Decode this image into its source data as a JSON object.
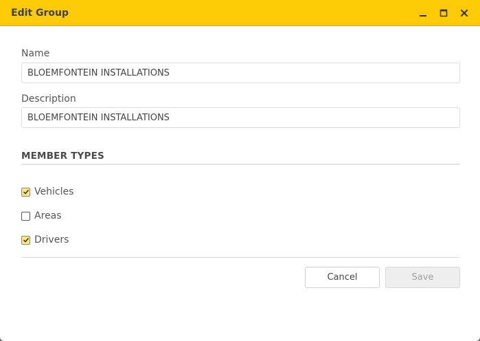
{
  "dialog": {
    "title": "Edit Group",
    "controls": {
      "minimize_icon": "minimize-icon",
      "maximize_icon": "maximize-icon",
      "close_icon": "close-icon"
    }
  },
  "form": {
    "name_label": "Name",
    "name_value": "BLOEMFONTEIN INSTALLATIONS",
    "description_label": "Description",
    "description_value": "BLOEMFONTEIN INSTALLATIONS"
  },
  "member_types": {
    "heading": "MEMBER TYPES",
    "items": [
      {
        "label": "Vehicles",
        "checked": true
      },
      {
        "label": "Areas",
        "checked": false
      },
      {
        "label": "Drivers",
        "checked": true
      }
    ]
  },
  "buttons": {
    "cancel_label": "Cancel",
    "save_label": "Save"
  },
  "colors": {
    "titlebar": "#fccb05",
    "checked_fill": "#fbe58a"
  }
}
